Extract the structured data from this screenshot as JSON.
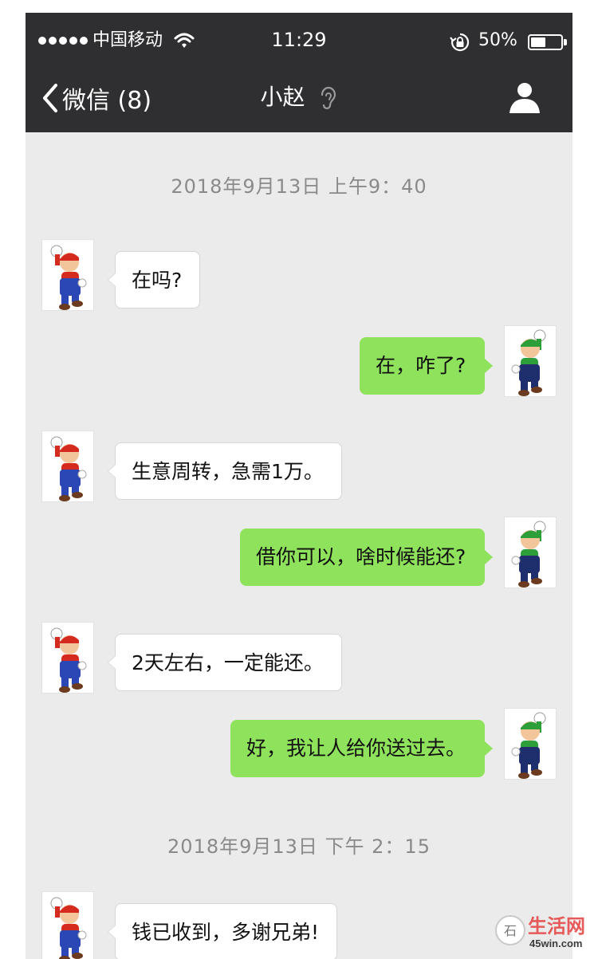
{
  "status_bar": {
    "carrier": "中国移动",
    "time": "11:29",
    "battery_percent": "50%",
    "battery_level": 0.5,
    "icons": [
      "signal-dots-icon",
      "wifi-icon",
      "rotation-lock-icon",
      "battery-icon"
    ]
  },
  "nav": {
    "back_label": "微信 (8)",
    "title": "小赵",
    "icons": [
      "chevron-left-icon",
      "ear-icon",
      "person-icon"
    ]
  },
  "messages": [
    {
      "type": "timestamp",
      "text": "2018年9月13日 上午9：40"
    },
    {
      "type": "bubble",
      "side": "in",
      "text": "在吗?"
    },
    {
      "type": "bubble",
      "side": "out",
      "text": "在，咋了?"
    },
    {
      "type": "bubble",
      "side": "in",
      "text": "生意周转，急需1万。"
    },
    {
      "type": "bubble",
      "side": "out",
      "text": "借你可以，啥时候能还?"
    },
    {
      "type": "bubble",
      "side": "in",
      "text": "2天左右，一定能还。"
    },
    {
      "type": "bubble",
      "side": "out",
      "text": "好，我让人给你送过去。"
    },
    {
      "type": "timestamp",
      "text": "2018年9月13日 下午 2：15"
    },
    {
      "type": "bubble",
      "side": "in",
      "text": "钱已收到，多谢兄弟!"
    }
  ],
  "watermark": {
    "text": "45win.com"
  },
  "colors": {
    "header": "#2f2f31",
    "background": "#ebebeb",
    "outgoing_bubble": "#8fe25b",
    "incoming_bubble": "#ffffff"
  }
}
